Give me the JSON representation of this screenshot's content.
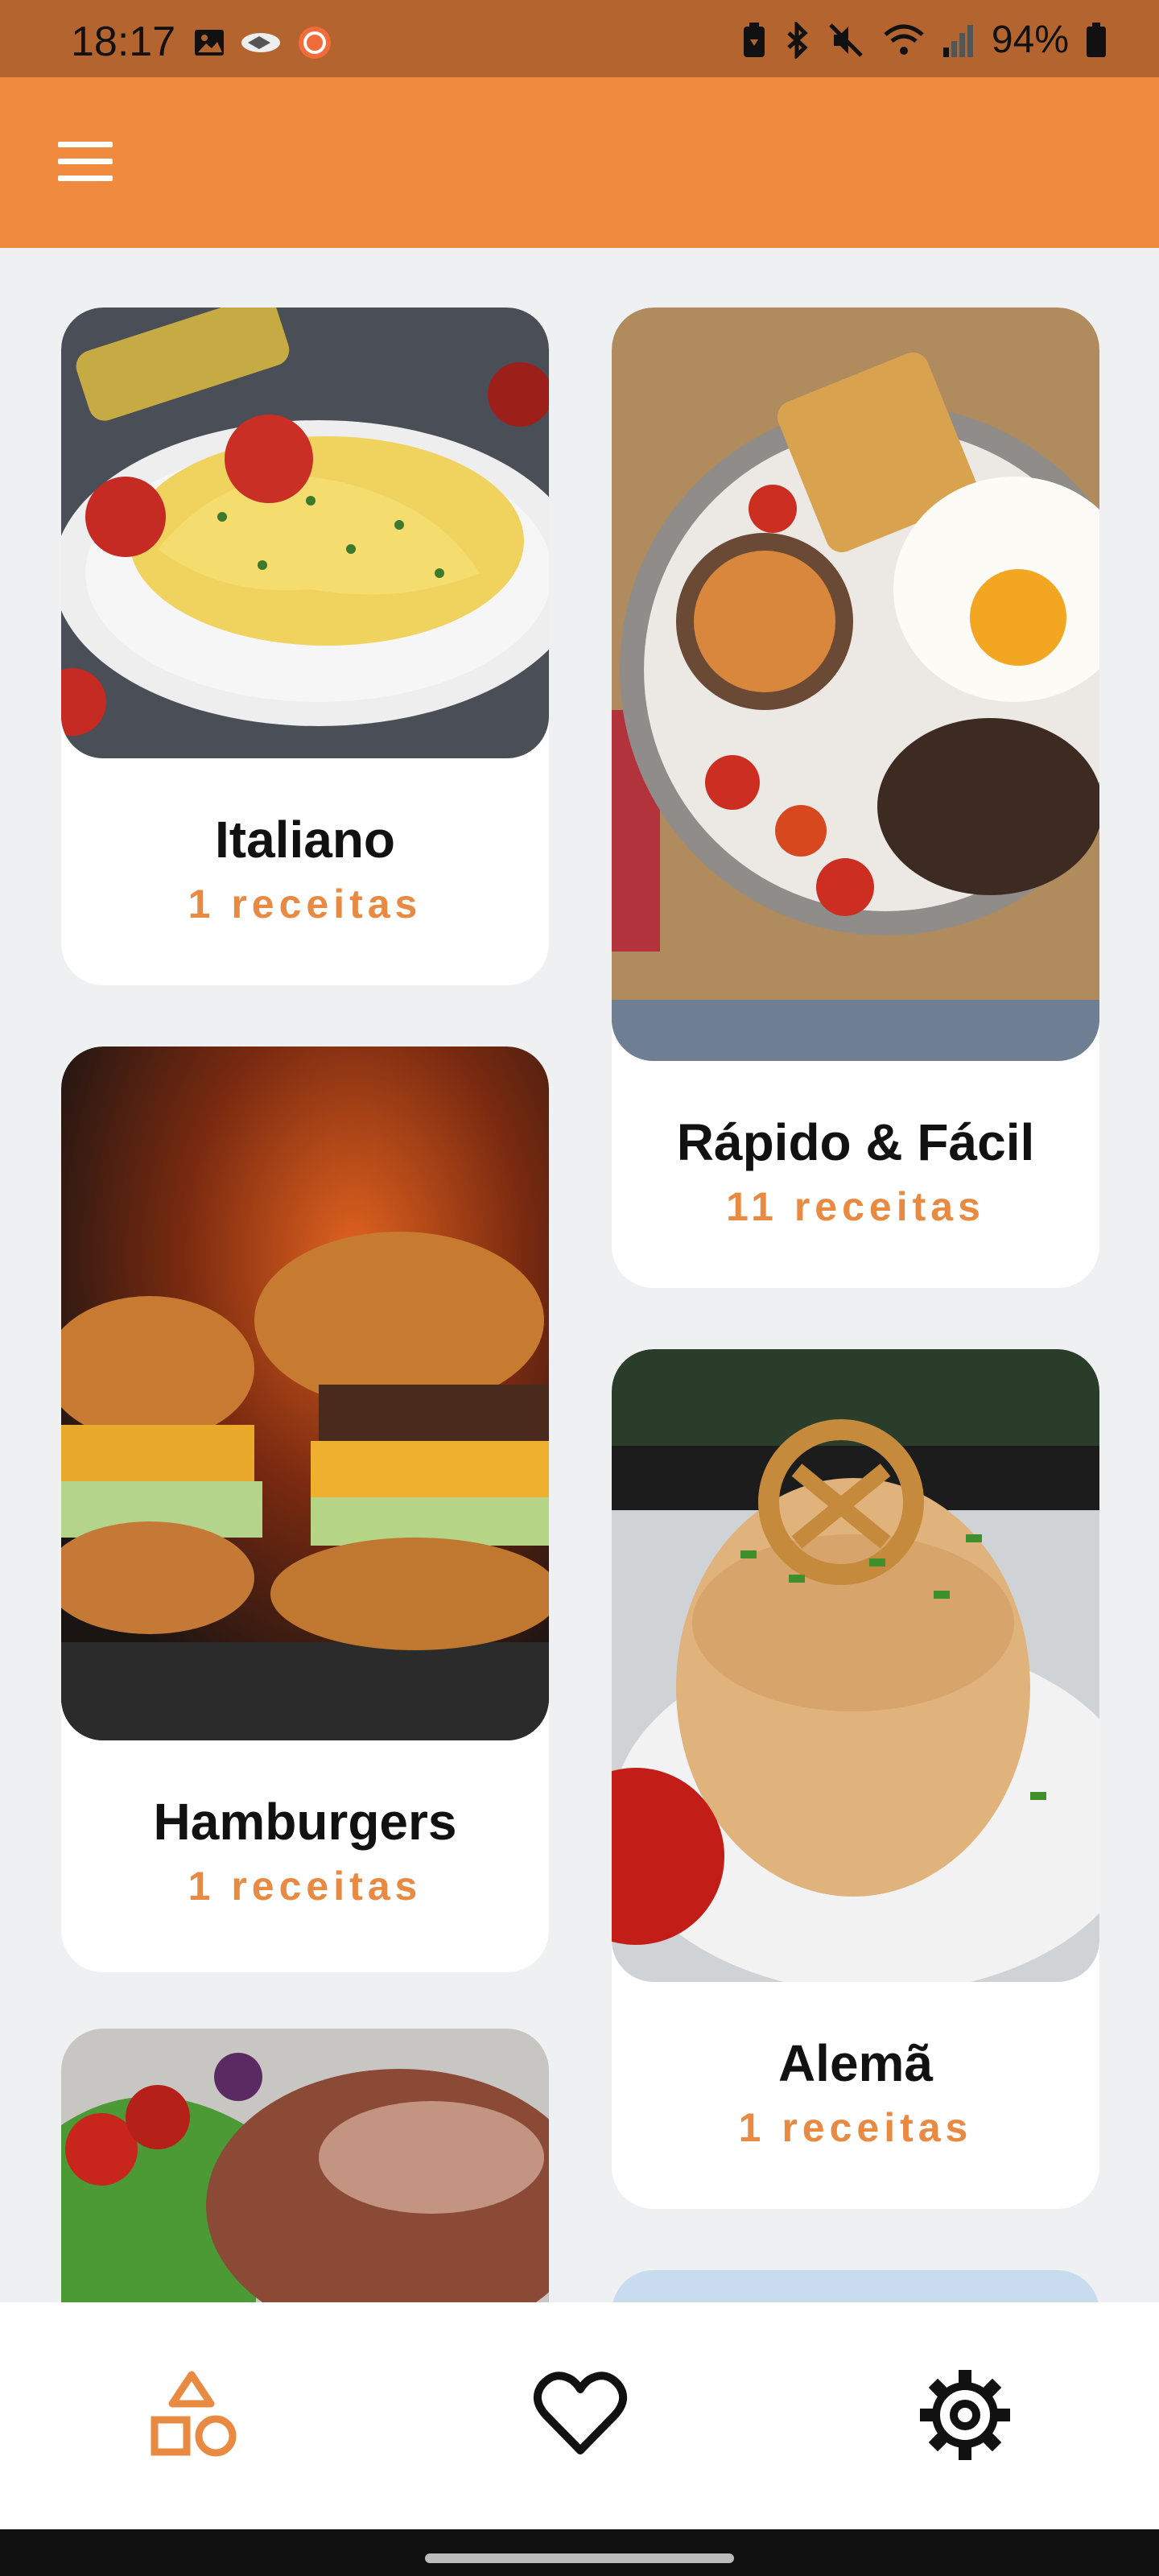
{
  "status_bar": {
    "time": "18:17",
    "battery": "94%",
    "icons_left": [
      "image-icon",
      "handshake-icon",
      "recorder-icon"
    ],
    "icons_right": [
      "battery-saver-icon",
      "bluetooth-icon",
      "mute-icon",
      "wifi-icon",
      "signal-icon",
      "battery-icon"
    ]
  },
  "app_bar": {
    "menu_icon": "hamburger-menu-icon",
    "background_color": "#ef8a3e"
  },
  "categories": [
    {
      "title": "Italiano",
      "count": "1 receitas"
    },
    {
      "title": "Rápido & Fácil",
      "count": "11 receitas"
    },
    {
      "title": "Hamburgers",
      "count": "1 receitas"
    },
    {
      "title": "Alemã",
      "count": "1 receitas"
    }
  ],
  "bottom_nav": {
    "items": [
      {
        "icon": "categories-shapes-icon",
        "active": true
      },
      {
        "icon": "heart-icon",
        "active": false
      },
      {
        "icon": "gear-icon",
        "active": false
      }
    ],
    "accent_color": "#e98a42"
  }
}
